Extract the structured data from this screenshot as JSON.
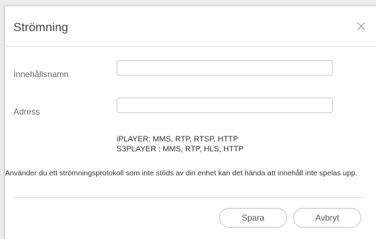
{
  "dialog": {
    "title": "Strömning",
    "close_icon": "close-icon"
  },
  "form": {
    "content_name_label": "Innehållsnamn",
    "content_name_value": "",
    "address_label": "Adress",
    "address_value": ""
  },
  "protocols": {
    "iplayer": "iPLAYER: MMS, RTP, RTSP, HTTP",
    "s3player": "S3PLAYER : MMS, RTP, HLS, HTTP"
  },
  "warning_text": "Använder du ett strömningsprotokoll som inte stöds av din enhet kan det hända att innehåll inte spelas upp.",
  "buttons": {
    "save": "Spara",
    "cancel": "Avbryt"
  }
}
